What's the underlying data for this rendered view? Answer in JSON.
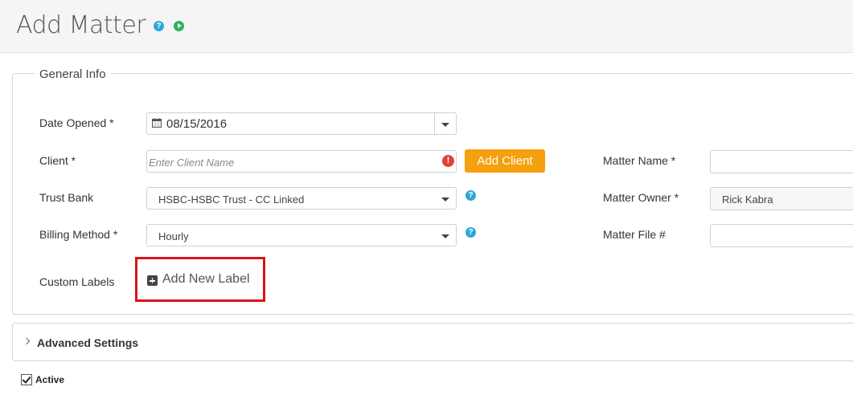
{
  "page": {
    "title": "Add Matter"
  },
  "header_icons": [
    "help-icon",
    "play-icon"
  ],
  "general_info": {
    "legend": "General Info",
    "date_opened": {
      "label": "Date Opened *",
      "value": "08/15/2016"
    },
    "client": {
      "label": "Client *",
      "placeholder": "Enter Client Name",
      "error_icon": "!",
      "add_button": "Add Client"
    },
    "trust_bank": {
      "label": "Trust Bank",
      "value": "HSBC-HSBC Trust - CC Linked"
    },
    "billing_method": {
      "label": "Billing Method *",
      "value": "Hourly"
    },
    "custom_labels": {
      "label": "Custom Labels",
      "add_label": "Add New Label"
    },
    "matter_name": {
      "label": "Matter Name *",
      "value": ""
    },
    "matter_owner": {
      "label": "Matter Owner *",
      "value": "Rick Kabra"
    },
    "matter_file": {
      "label": "Matter File #",
      "value": ""
    }
  },
  "advanced_settings": {
    "label": "Advanced Settings"
  },
  "active": {
    "label": "Active",
    "checked": true
  },
  "colors": {
    "accent_orange": "#f5a00e",
    "help_blue": "#2fa6d8",
    "highlight_red": "#d9141a"
  }
}
